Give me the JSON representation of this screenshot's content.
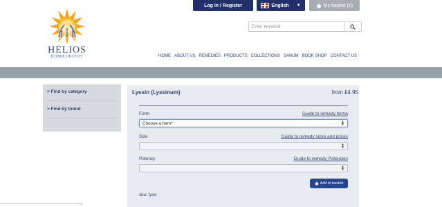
{
  "header": {
    "login_label": "Log in / Register",
    "language_label": "English",
    "basket_label": "My basket (0)",
    "search_placeholder": "Enter keyword"
  },
  "logo": {
    "name": "HELIOS",
    "subtitle": "HOMŒOPATHY"
  },
  "nav": [
    "HOME",
    "ABOUT US",
    "REMEDIES",
    "PRODUCTS",
    "COLLECTIONS",
    "SANUM",
    "BOOK SHOP",
    "CONTACT US"
  ],
  "sidebar": {
    "items": [
      "Find by category",
      "Find by brand"
    ]
  },
  "product": {
    "title": "Lyssin (Lyssinum)",
    "price": "from £4.95",
    "form_label": "Form",
    "form_guide": "Guide to remedy forms",
    "form_value": "Choose a form*",
    "size_label": "Size",
    "size_guide": "Guide to remedy sizes and prices",
    "potency_label": "Potency",
    "potency_guide": "Guide to remedy Potencies",
    "add_to_basket": "Add to basket",
    "sku_label": "sku:",
    "sku_value": "lysa"
  },
  "colors": {
    "navy": "#21306a",
    "band": "#96a1aa",
    "panel": "#e8ecf0",
    "sidebar": "#d6dadf",
    "button": "#26478f"
  },
  "icons": [
    "basket-icon",
    "uk-flag-icon",
    "search-icon",
    "select-arrows-icon",
    "chevron-right-icon",
    "sun-logo-icon"
  ]
}
